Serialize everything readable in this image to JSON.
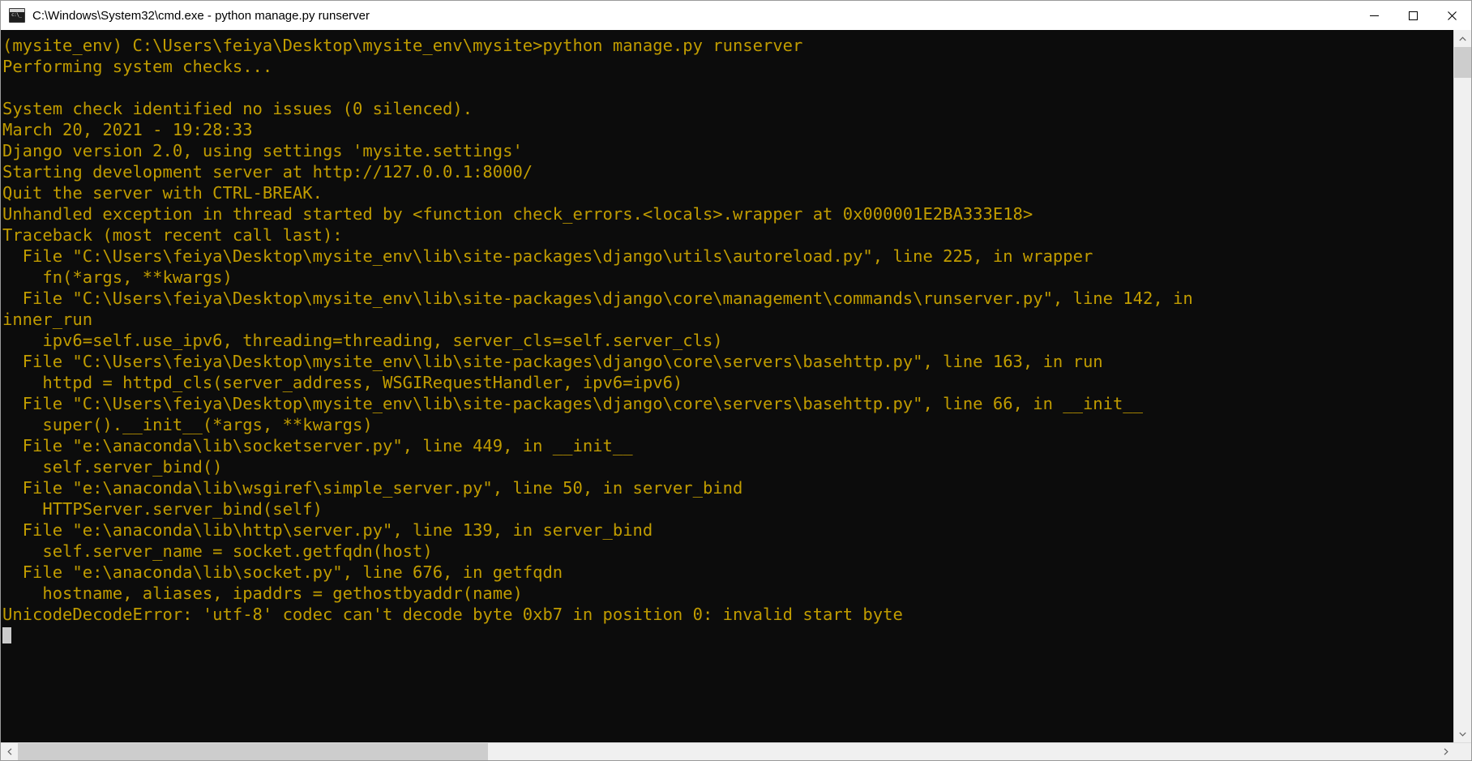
{
  "window": {
    "title": "C:\\Windows\\System32\\cmd.exe - python  manage.py runserver",
    "icon": "cmd-console-icon",
    "controls": {
      "minimize": "minimize-icon",
      "maximize": "maximize-icon",
      "close": "close-icon"
    },
    "colors": {
      "titlebar_bg": "#ffffff",
      "title_text": "#000000",
      "console_bg": "#0c0c0c",
      "console_text": "#c19c00",
      "scrollbar_track": "#f0f0f0",
      "scrollbar_thumb": "#cdcdcd"
    }
  },
  "console": {
    "lines": [
      "(mysite_env) C:\\Users\\feiya\\Desktop\\mysite_env\\mysite>python manage.py runserver",
      "Performing system checks...",
      "",
      "System check identified no issues (0 silenced).",
      "March 20, 2021 - 19:28:33",
      "Django version 2.0, using settings 'mysite.settings'",
      "Starting development server at http://127.0.0.1:8000/",
      "Quit the server with CTRL-BREAK.",
      "Unhandled exception in thread started by <function check_errors.<locals>.wrapper at 0x000001E2BA333E18>",
      "Traceback (most recent call last):",
      "  File \"C:\\Users\\feiya\\Desktop\\mysite_env\\lib\\site-packages\\django\\utils\\autoreload.py\", line 225, in wrapper",
      "    fn(*args, **kwargs)",
      "  File \"C:\\Users\\feiya\\Desktop\\mysite_env\\lib\\site-packages\\django\\core\\management\\commands\\runserver.py\", line 142, in",
      "inner_run",
      "    ipv6=self.use_ipv6, threading=threading, server_cls=self.server_cls)",
      "  File \"C:\\Users\\feiya\\Desktop\\mysite_env\\lib\\site-packages\\django\\core\\servers\\basehttp.py\", line 163, in run",
      "    httpd = httpd_cls(server_address, WSGIRequestHandler, ipv6=ipv6)",
      "  File \"C:\\Users\\feiya\\Desktop\\mysite_env\\lib\\site-packages\\django\\core\\servers\\basehttp.py\", line 66, in __init__",
      "    super().__init__(*args, **kwargs)",
      "  File \"e:\\anaconda\\lib\\socketserver.py\", line 449, in __init__",
      "    self.server_bind()",
      "  File \"e:\\anaconda\\lib\\wsgiref\\simple_server.py\", line 50, in server_bind",
      "    HTTPServer.server_bind(self)",
      "  File \"e:\\anaconda\\lib\\http\\server.py\", line 139, in server_bind",
      "    self.server_name = socket.getfqdn(host)",
      "  File \"e:\\anaconda\\lib\\socket.py\", line 676, in getfqdn",
      "    hostname, aliases, ipaddrs = gethostbyaddr(name)",
      "UnicodeDecodeError: 'utf-8' codec can't decode byte 0xb7 in position 0: invalid start byte"
    ]
  },
  "scrollbars": {
    "vertical": {
      "up_arrow": "chevron-up-icon",
      "down_arrow": "chevron-down-icon"
    },
    "horizontal": {
      "left_arrow": "chevron-left-icon",
      "right_arrow": "chevron-right-icon"
    }
  }
}
